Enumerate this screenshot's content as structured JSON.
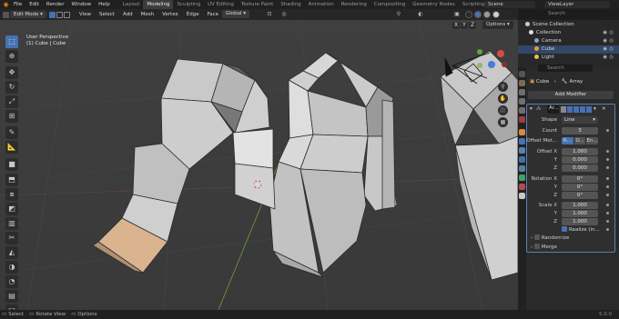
{
  "topbar": {
    "menus": [
      "File",
      "Edit",
      "Render",
      "Window",
      "Help"
    ],
    "workspaces": [
      "Layout",
      "Modeling",
      "Sculpting",
      "UV Editing",
      "Texture Paint",
      "Shading",
      "Animation",
      "Rendering",
      "Compositing",
      "Geometry Nodes",
      "Scripting"
    ],
    "active_workspace": "Modeling",
    "scene": "Scene",
    "view_layer": "ViewLayer"
  },
  "viewport_header": {
    "mode": "Edit Mode",
    "menus": [
      "View",
      "Select",
      "Add",
      "Mesh",
      "Vertex",
      "Edge",
      "Face",
      "UV"
    ],
    "pivot": "Global",
    "mirror_axes": [
      "X",
      "Y",
      "Z"
    ],
    "options_label": "Options"
  },
  "viewport": {
    "view_name": "User Perspective",
    "object_info": "(1) Cube | Cube",
    "accent_color": "#4772b3",
    "selected_face_color": "#d9b48f"
  },
  "outliner": {
    "search_placeholder": "Search",
    "items": [
      {
        "label": "Scene Collection",
        "icon": "collection-icon"
      },
      {
        "label": "Collection",
        "icon": "collection-icon"
      },
      {
        "label": "Camera",
        "icon": "camera-icon"
      },
      {
        "label": "Cube",
        "icon": "mesh-icon"
      },
      {
        "label": "Light",
        "icon": "light-icon"
      }
    ]
  },
  "properties": {
    "search_placeholder": "Search",
    "object": "Cube",
    "modifier_type": "Array",
    "add_modifier": "Add Modifier",
    "modifier_name": "Ar...",
    "fields": [
      {
        "label": "Shape",
        "value": "Line"
      },
      {
        "label": "Count",
        "value": "3"
      },
      {
        "label": "Offset Met...",
        "value": "R..."
      },
      {
        "label": "Offset X",
        "value": "1.000"
      },
      {
        "label": "Y",
        "value": "0.000"
      },
      {
        "label": "Z",
        "value": "0.000"
      },
      {
        "label": "Rotation X",
        "value": "0°"
      },
      {
        "label": "Y",
        "value": "0°"
      },
      {
        "label": "Z",
        "value": "0°"
      },
      {
        "label": "Scale X",
        "value": "1.000"
      },
      {
        "label": "Y",
        "value": "1.000"
      },
      {
        "label": "Z",
        "value": "1.000"
      }
    ],
    "offset_method_alt": [
      "O...",
      "En..."
    ],
    "realize": "Realize (in...",
    "subpanels": [
      "Randomize",
      "Merge"
    ]
  },
  "statusbar": {
    "items": [
      "Select",
      "Rotate View",
      "Options"
    ],
    "version": "5.0.0"
  }
}
